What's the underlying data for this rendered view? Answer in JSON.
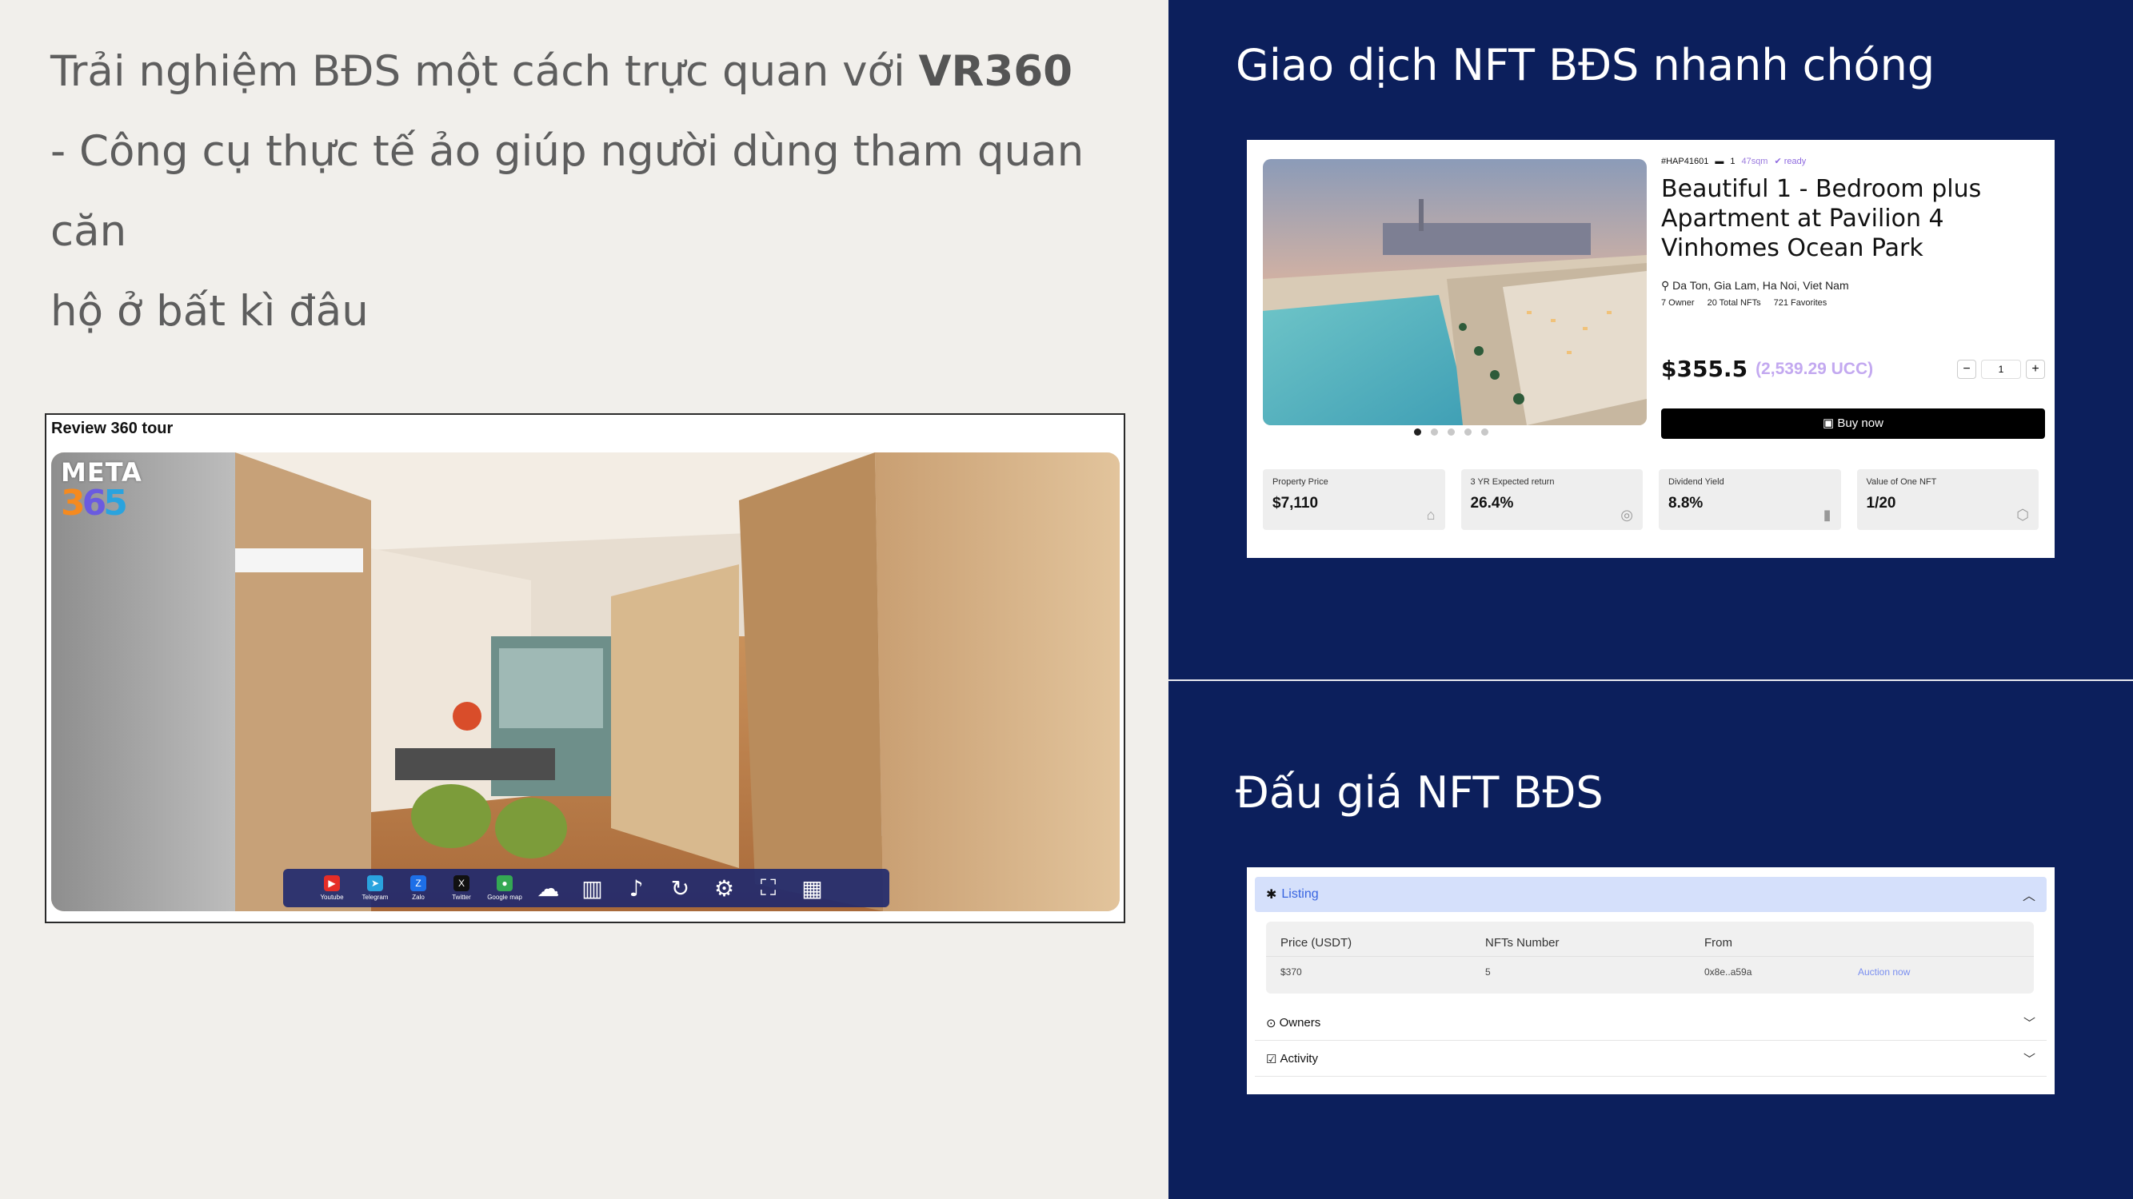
{
  "left": {
    "hero_line1_pre": "Trải nghiệm BĐS một cách trực quan với ",
    "hero_line1_bold": "VR360",
    "hero_line2": "- Công cụ thực tế ảo giúp người dùng tham quan căn",
    "hero_line3": "hộ ở bất kì đâu",
    "tour": {
      "title": "Review 360 tour",
      "logo_top": "META",
      "logo_num": "365",
      "social": [
        {
          "label": "Youtube",
          "color": "#e52d27",
          "icon": "youtube-icon",
          "glyph": "▶"
        },
        {
          "label": "Telegram",
          "color": "#2aa3de",
          "icon": "telegram-icon",
          "glyph": "➤"
        },
        {
          "label": "Zalo",
          "color": "#1d6fe8",
          "icon": "zalo-icon",
          "glyph": "Z"
        },
        {
          "label": "Twitter",
          "color": "#111111",
          "icon": "x-twitter-icon",
          "glyph": "X"
        },
        {
          "label": "Google map",
          "color": "#34a853",
          "icon": "map-pin-icon",
          "glyph": "●"
        }
      ],
      "tools": [
        {
          "icon": "cloud-download-icon",
          "glyph": "☁"
        },
        {
          "icon": "book-icon",
          "glyph": "▥"
        },
        {
          "icon": "speaker-icon",
          "glyph": "♪"
        },
        {
          "icon": "rotate-icon",
          "glyph": "↻"
        },
        {
          "icon": "gear-icon",
          "glyph": "⚙"
        },
        {
          "icon": "fullscreen-icon",
          "glyph": "⛶"
        },
        {
          "icon": "map-icon",
          "glyph": "▦"
        }
      ]
    }
  },
  "right": {
    "heading1": "Giao dịch NFT BĐS nhanh chóng",
    "heading2": "Đấu giá NFT BĐS",
    "nft": {
      "code": "#HAP41601",
      "rooms": "1",
      "area": "47sqm",
      "status": "ready",
      "title": "Beautiful 1 - Bedroom plus Apartment at Pavilion 4 Vinhomes Ocean Park",
      "location": "Da Ton, Gia Lam, Ha Noi, Viet Nam",
      "owners": "7 Owner",
      "total_nfts": "20 Total NFTs",
      "favorites": "721 Favorites",
      "price": "$355.5",
      "price_ucc": "(2,539.29 UCC)",
      "qty_minus": "−",
      "qty_value": "1",
      "qty_plus": "+",
      "buy_label": "Buy now",
      "metrics": [
        {
          "label": "Property Price",
          "value": "$7,110",
          "icon": "home-icon",
          "glyph": "⌂"
        },
        {
          "label": "3 YR Expected return",
          "value": "26.4%",
          "icon": "coins-icon",
          "glyph": "◎"
        },
        {
          "label": "Dividend Yield",
          "value": "8.8%",
          "icon": "chart-icon",
          "glyph": "▮"
        },
        {
          "label": "Value of One NFT",
          "value": "1/20",
          "icon": "cube-icon",
          "glyph": "⬡"
        }
      ]
    },
    "auction": {
      "listing_label": "Listing",
      "headers": [
        "Price (USDT)",
        "NFTs Number",
        "From"
      ],
      "row": {
        "price": "$370",
        "number": "5",
        "from": "0x8e..a59a",
        "action": "Auction now"
      },
      "owners_label": "Owners",
      "activity_label": "Activity"
    }
  }
}
